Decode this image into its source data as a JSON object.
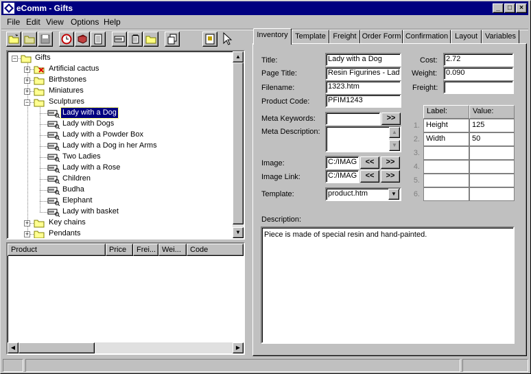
{
  "window": {
    "title": "eComm - Gifts"
  },
  "menu": [
    "File",
    "Edit",
    "View",
    "Options",
    "Help"
  ],
  "tree": {
    "root": "Gifts",
    "categories": [
      {
        "label": "Artificial cactus"
      },
      {
        "label": "Birthstones"
      },
      {
        "label": "Miniatures"
      },
      {
        "label": "Sculptures"
      },
      {
        "label": "Key chains"
      },
      {
        "label": "Pendants"
      }
    ],
    "products": [
      "Lady with a Dog",
      "Lady with Dogs",
      "Lady with a Powder Box",
      "Lady with a Dog in her Arms",
      "Two Ladies",
      "Lady with a Rose",
      "Children",
      "Budha",
      "Elephant",
      "Lady with basket"
    ]
  },
  "product_list": {
    "columns": [
      "Product",
      "Price",
      "Frei...",
      "Wei...",
      "Code"
    ]
  },
  "tabs": [
    "Inventory",
    "Template",
    "Freight",
    "Order Form",
    "Confirmation",
    "Layout",
    "Variables"
  ],
  "form": {
    "title_label": "Title:",
    "title_value": "Lady with a Dog",
    "page_title_label": "Page Title:",
    "page_title_value": "Resin Figurines - Lady",
    "filename_label": "Filename:",
    "filename_value": "1323.htm",
    "product_code_label": "Product Code:",
    "product_code_value": "PFIM1243",
    "meta_keywords_label": "Meta Keywords:",
    "meta_keywords_value": "",
    "meta_description_label": "Meta Description:",
    "meta_description_value": "",
    "image_label": "Image:",
    "image_value": "C:/IMAG",
    "image_link_label": "Image Link:",
    "image_link_value": "C:/IMAG",
    "template_label": "Template:",
    "template_value": "product.htm",
    "cost_label": "Cost:",
    "cost_value": "2.72",
    "weight_label": "Weight:",
    "weight_value": "0.090",
    "freight_label": "Freight:",
    "freight_value": "",
    "description_label": "Description:",
    "description_value": "Piece is made of special resin and hand-painted.",
    "btn_next": ">>",
    "btn_prev": "<<"
  },
  "attributes": {
    "label_header": "Label:",
    "value_header": "Value:",
    "rows": [
      {
        "num": "1.",
        "label": "Height",
        "value": "125"
      },
      {
        "num": "2.",
        "label": "Width",
        "value": "50"
      },
      {
        "num": "3.",
        "label": "",
        "value": ""
      },
      {
        "num": "4.",
        "label": "",
        "value": ""
      },
      {
        "num": "5.",
        "label": "",
        "value": ""
      },
      {
        "num": "6.",
        "label": "",
        "value": ""
      }
    ]
  }
}
